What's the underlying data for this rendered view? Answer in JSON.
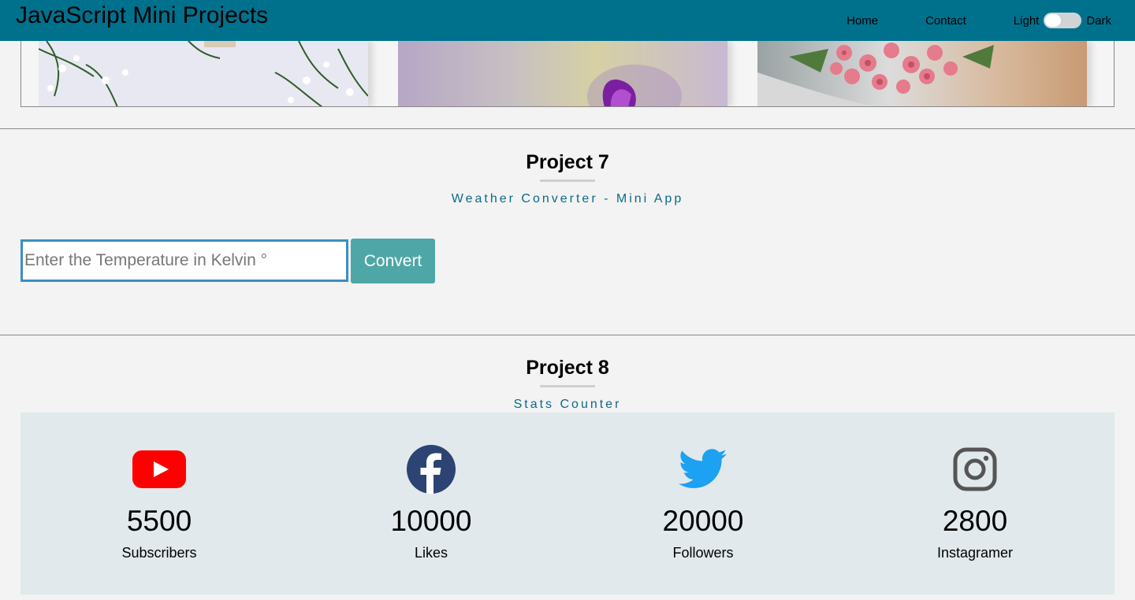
{
  "header": {
    "title": "JavaScript Mini Projects",
    "nav": {
      "home": "Home",
      "contact": "Contact"
    },
    "theme": {
      "light_label": "Light",
      "dark_label": "Dark",
      "mode": "light"
    },
    "color": "#00718d"
  },
  "project7": {
    "title": "Project 7",
    "subtitle": "Weather Converter - Mini App",
    "input_placeholder": "Enter the Temperature in Kelvin °",
    "input_value": "",
    "button_label": "Convert"
  },
  "project8": {
    "title": "Project 8",
    "subtitle": "Stats Counter",
    "stats": [
      {
        "icon": "youtube-icon",
        "value": "5500",
        "label": "Subscribers",
        "color": "#ff0000"
      },
      {
        "icon": "facebook-icon",
        "value": "10000",
        "label": "Likes",
        "color": "#2d4373"
      },
      {
        "icon": "twitter-icon",
        "value": "20000",
        "label": "Followers",
        "color": "#1da1f2"
      },
      {
        "icon": "instagram-icon",
        "value": "2800",
        "label": "Instagramer",
        "color": "#555555"
      }
    ]
  }
}
